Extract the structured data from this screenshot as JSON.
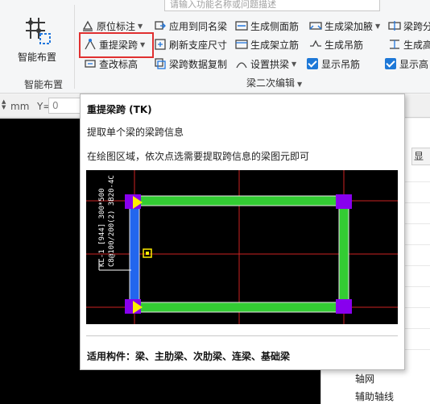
{
  "search": {
    "placeholder": "请输入功能名称或问题描述"
  },
  "ribbon": {
    "smart_layout": {
      "label": "智能布置",
      "group_label": "智能布置"
    },
    "group_label": "梁二次编辑",
    "row1": [
      {
        "name": "original-annotation",
        "label": "原位标注",
        "dropdown": true
      },
      {
        "name": "apply-same-name",
        "label": "应用到同名梁",
        "dropdown": false
      },
      {
        "name": "gen-side-rebar",
        "label": "生成侧面筋",
        "dropdown": false
      },
      {
        "name": "gen-haunch",
        "label": "生成梁加腋",
        "dropdown": true
      },
      {
        "name": "beam-span-split",
        "label": "梁跨分",
        "dropdown": false
      }
    ],
    "row2": [
      {
        "name": "re-extract-span",
        "label": "重提梁跨",
        "dropdown": true
      },
      {
        "name": "refresh-support",
        "label": "刷新支座尺寸",
        "dropdown": false
      },
      {
        "name": "gen-stirrup",
        "label": "生成架立筋",
        "dropdown": false
      },
      {
        "name": "gen-hanger",
        "label": "生成吊筋",
        "dropdown": false
      },
      {
        "name": "gen-height",
        "label": "生成高",
        "dropdown": false
      }
    ],
    "row3": [
      {
        "name": "edit-elevation",
        "label": "查改标高",
        "dropdown": false
      },
      {
        "name": "copy-span-data",
        "label": "梁跨数据复制",
        "dropdown": false
      },
      {
        "name": "set-arch-beam",
        "label": "设置拱梁",
        "dropdown": true
      },
      {
        "name": "show-hanger",
        "label": "显示吊筋",
        "checked": true
      },
      {
        "name": "show-height",
        "label": "显示高",
        "checked": true
      }
    ]
  },
  "coord": {
    "unit": "mm",
    "y_label": "Y=",
    "y_value": "0"
  },
  "right_panel": {
    "tab_label": "显示",
    "tree": [
      "轴网",
      "辅助轴线"
    ]
  },
  "tooltip": {
    "title": "重提梁跨 (TK)",
    "description": "提取单个梁的梁跨信息",
    "instruction": "在绘图区域，依次点选需要提取跨信息的梁图元即可",
    "image_labels": {
      "beam_text_1": "KL-1 [944] 300*500",
      "beam_text_2": "C8@100/200(2) 3B20-4C",
      "beam_text_3": "3B20;4C"
    },
    "footer": "适用构件：梁、主肋梁、次肋梁、连梁、基础梁"
  },
  "colors": {
    "beam": "#33cc33",
    "support": "#8800ee",
    "selected_beam": "#2266ee",
    "axis": "#cc2222",
    "highlight": "#e03030"
  }
}
